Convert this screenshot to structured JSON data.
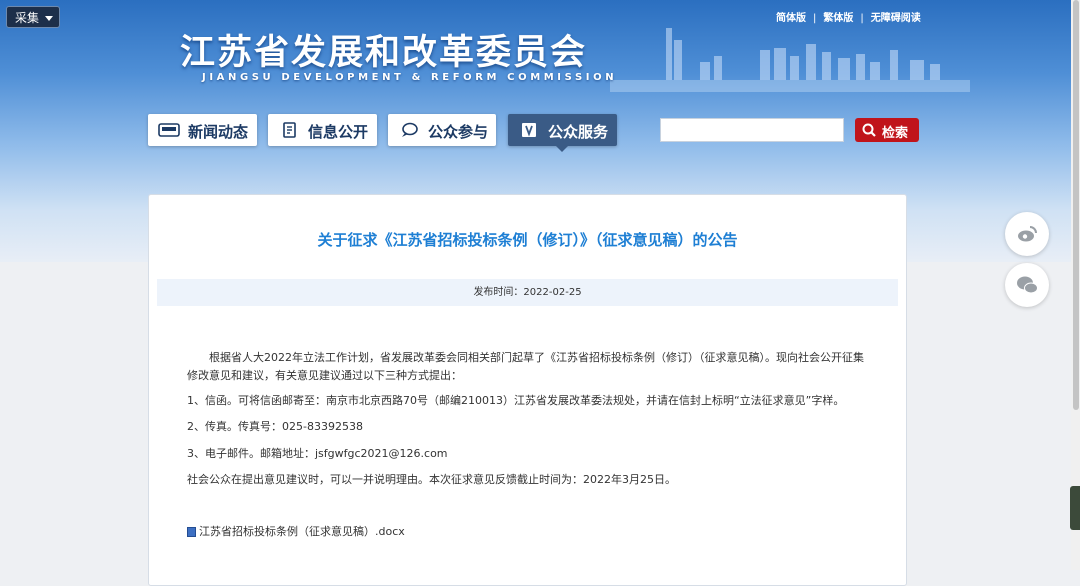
{
  "header": {
    "collect_label": "采集",
    "links": [
      "简体版",
      "繁体版",
      "无障碍阅读"
    ],
    "link_separator": "|",
    "title": "江苏省发展和改革委员会",
    "subtitle": "JIANGSU DEVELOPMENT & REFORM COMMISSION"
  },
  "nav": {
    "items": [
      {
        "label": "新闻动态",
        "icon": "news-icon",
        "active": false
      },
      {
        "label": "信息公开",
        "icon": "document-icon",
        "active": false
      },
      {
        "label": "公众参与",
        "icon": "chat-icon",
        "active": false
      },
      {
        "label": "公众服务",
        "icon": "service-book-icon",
        "active": true
      }
    ]
  },
  "search": {
    "placeholder": "",
    "value": "",
    "button_label": "检索"
  },
  "article": {
    "title": "关于征求《江苏省招标投标条例（修订）》（征求意见稿）的公告",
    "publish_time": "发布时间：2022-02-25",
    "paragraphs": [
      "根据省人大2022年立法工作计划，省发展改革委会同相关部门起草了《江苏省招标投标条例（修订）（征求意见稿）。现向社会公开征集",
      "修改意见和建议，有关意见建议通过以下三种方式提出：",
      "1、信函。可将信函邮寄至：南京市北京西路70号（邮编210013）江苏省发展改革委法规处，并请在信封上标明“立法征求意见”字样。",
      "2、传真。传真号：025-83392538",
      "3、电子邮件。邮箱地址：jsfgwfgc2021@126.com",
      "社会公众在提出意见建议时，可以一并说明理由。本次征求意见反馈截止时间为：2022年3月25日。"
    ],
    "attachment": "江苏省招标投标条例（征求意见稿）.docx"
  },
  "share": [
    "weibo-icon",
    "wechat-icon"
  ],
  "colors": {
    "accent": "#1e7fd4",
    "search_button": "#c0141b",
    "active_nav": "#3a5b86"
  }
}
